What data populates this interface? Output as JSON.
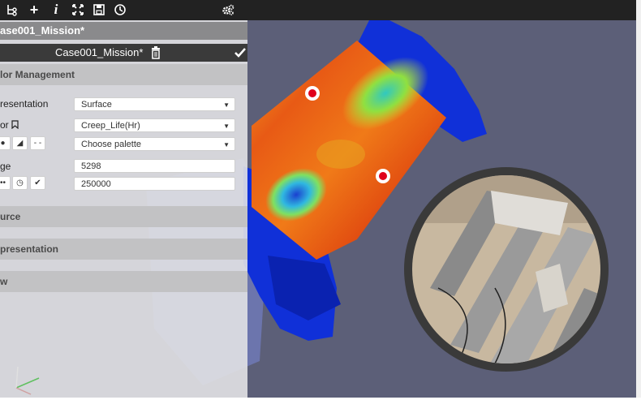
{
  "toolbar": {
    "icons": [
      "pipeline-icon",
      "add-icon",
      "info-icon",
      "fullscreen-icon",
      "save-icon",
      "history-icon",
      "settings-icon"
    ]
  },
  "panel": {
    "title": "ase001_Mission*",
    "pipeline_name": "Case001_Mission*",
    "sections": {
      "color_management": "lor Management",
      "source": "urce",
      "representation": "presentation",
      "view": "w"
    },
    "rows": {
      "representation_label": "resentation",
      "representation_value": "Surface",
      "color_label": "or",
      "color_value": "Creep_Life(Hr)",
      "palette_value": "Choose palette",
      "range_label": "ge",
      "range_min": "5298",
      "range_max": "250000"
    }
  },
  "colors": {
    "toolbar_bg": "#222222",
    "viewport_bg": "#5c5f78",
    "marker_red": "#e0001b"
  }
}
